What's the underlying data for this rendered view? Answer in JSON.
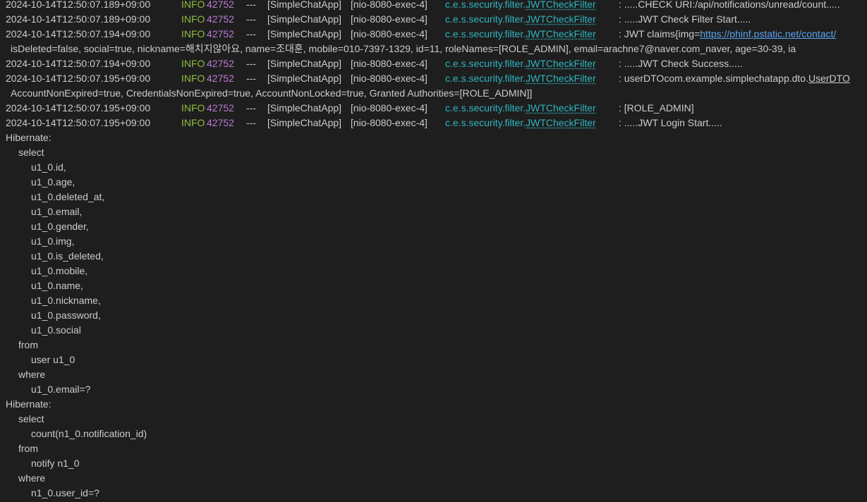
{
  "log": {
    "entries": [
      {
        "timestamp": "2024-10-14T12:50:07.189+09:00",
        "level": "INFO",
        "pid": "42752",
        "sep": "---",
        "app": "[SimpleChatApp]",
        "thread": "[nio-8080-exec-4]",
        "logger_prefix": "c.e.s.security.filter.",
        "logger_class": "JWTCheckFilter",
        "message": ": .....CHECK URI:/api/notifications/unread/count....."
      },
      {
        "timestamp": "2024-10-14T12:50:07.189+09:00",
        "level": "INFO",
        "pid": "42752",
        "sep": "---",
        "app": "[SimpleChatApp]",
        "thread": "[nio-8080-exec-4]",
        "logger_prefix": "c.e.s.security.filter.",
        "logger_class": "JWTCheckFilter",
        "message": ": .....JWT Check Filter Start....."
      },
      {
        "timestamp": "2024-10-14T12:50:07.194+09:00",
        "level": "INFO",
        "pid": "42752",
        "sep": "---",
        "app": "[SimpleChatApp]",
        "thread": "[nio-8080-exec-4]",
        "logger_prefix": "c.e.s.security.filter.",
        "logger_class": "JWTCheckFilter",
        "message_prefix": ": JWT claims{img=",
        "message_link": "https://phinf.pstatic.net/contact/"
      },
      {
        "timestamp": "2024-10-14T12:50:07.194+09:00",
        "level": "INFO",
        "pid": "42752",
        "sep": "---",
        "app": "[SimpleChatApp]",
        "thread": "[nio-8080-exec-4]",
        "logger_prefix": "c.e.s.security.filter.",
        "logger_class": "JWTCheckFilter",
        "message": ": .....JWT Check Success....."
      },
      {
        "timestamp": "2024-10-14T12:50:07.195+09:00",
        "level": "INFO",
        "pid": "42752",
        "sep": "---",
        "app": "[SimpleChatApp]",
        "thread": "[nio-8080-exec-4]",
        "logger_prefix": "c.e.s.security.filter.",
        "logger_class": "JWTCheckFilter",
        "message_prefix": ": userDTOcom.example.simplechatapp.dto.",
        "message_underlined": "UserDTO"
      },
      {
        "timestamp": "2024-10-14T12:50:07.195+09:00",
        "level": "INFO",
        "pid": "42752",
        "sep": "---",
        "app": "[SimpleChatApp]",
        "thread": "[nio-8080-exec-4]",
        "logger_prefix": "c.e.s.security.filter.",
        "logger_class": "JWTCheckFilter",
        "message": ": [ROLE_ADMIN]"
      },
      {
        "timestamp": "2024-10-14T12:50:07.195+09:00",
        "level": "INFO",
        "pid": "42752",
        "sep": "---",
        "app": "[SimpleChatApp]",
        "thread": "[nio-8080-exec-4]",
        "logger_prefix": "c.e.s.security.filter.",
        "logger_class": "JWTCheckFilter",
        "message": ": .....JWT Login Start....."
      }
    ],
    "continuations": {
      "claims": "isDeleted=false, social=true, nickname=해치지않아요, name=조대훈, mobile=010-7397-1329, id=11, roleNames=[ROLE_ADMIN], email=arachne7@naver.com_naver, age=30-39, ia",
      "user_dto": "AccountNonExpired=true, CredentialsNonExpired=true, AccountNonLocked=true, Granted Authorities=[ROLE_ADMIN]]"
    },
    "hibernate": [
      {
        "label": "Hibernate:",
        "select_kw": "select",
        "columns": [
          "u1_0.id,",
          "u1_0.age,",
          "u1_0.deleted_at,",
          "u1_0.email,",
          "u1_0.gender,",
          "u1_0.img,",
          "u1_0.is_deleted,",
          "u1_0.mobile,",
          "u1_0.name,",
          "u1_0.nickname,",
          "u1_0.password,",
          "u1_0.social"
        ],
        "from_kw": "from",
        "table": "user u1_0",
        "where_kw": "where",
        "condition": "u1_0.email=?"
      },
      {
        "label": "Hibernate:",
        "select_kw": "select",
        "columns": [
          "count(n1_0.notification_id)"
        ],
        "from_kw": "from",
        "table": "notify n1_0",
        "where_kw": "where",
        "condition": "n1_0.user_id=?"
      }
    ],
    "colors": {
      "background": "#1e1e1e",
      "text": "#cccccc",
      "level_info": "#8fbc3e",
      "pid": "#bc79d4",
      "logger": "#2eb5c0",
      "link": "#5aa4f2"
    }
  }
}
